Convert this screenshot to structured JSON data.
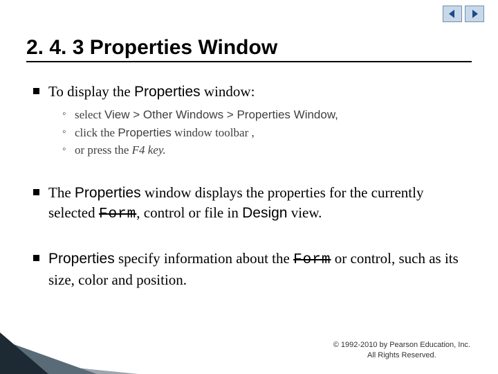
{
  "title": "2. 4. 3 Properties Window",
  "b1": {
    "pre": "To display the ",
    "mid": "Properties",
    "post": " window:"
  },
  "sub1": {
    "pre": "select ",
    "mid": "View > Other Windows > Properties Window,"
  },
  "sub2": {
    "pre": "click the ",
    "mid": "Properties",
    "post": " window toolbar ,"
  },
  "sub3": {
    "pre": "or press the ",
    "mid": "F4 key."
  },
  "b2": {
    "s1": "The ",
    "s2": "Properties",
    "s3": " window",
    "s4": " displays the properties for the currently selected ",
    "s5": "Form",
    "s6": ", control or file in ",
    "s7": "Design",
    "s8": " view."
  },
  "b3": {
    "s1": "Properties",
    "s2": " specify information about the ",
    "s3": "Form",
    "s4": " or control, such as its size, color and position."
  },
  "footer": {
    "l1": "© 1992-2010 by Pearson Education, Inc.",
    "l2": "All Rights Reserved."
  }
}
